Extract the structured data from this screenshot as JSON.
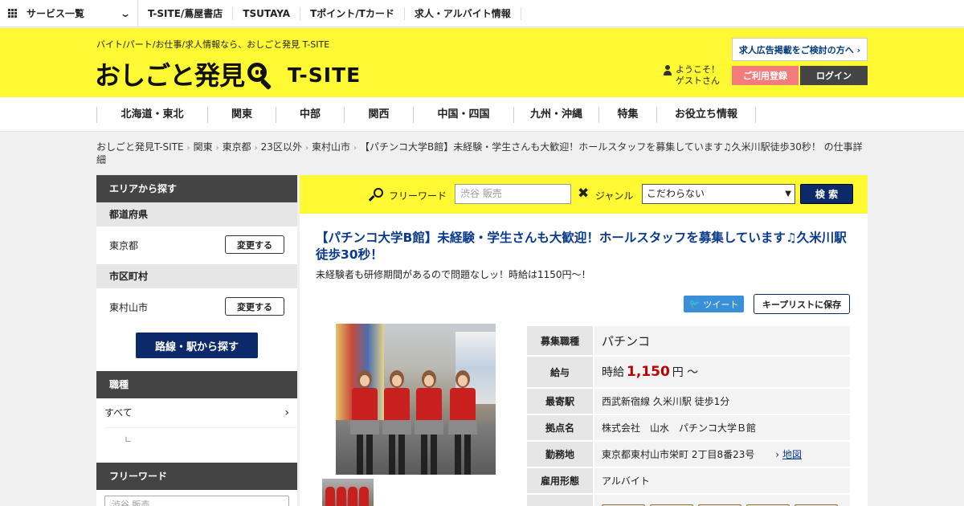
{
  "topbar": {
    "services": "サービス一覧",
    "links": [
      "T-SITE/蔦屋書店",
      "TSUTAYA",
      "Tポイント/Tカード",
      "求人・アルバイト情報"
    ]
  },
  "header": {
    "tagline": "バイト/パート/お仕事/求人情報なら、おしごと発見 T-SITE",
    "logo_main": "おしごと発見",
    "logo_sub": "T-SITE",
    "ad_button": "求人広告掲載をご検討の方へ ›",
    "welcome_line1": "ようこそ！",
    "welcome_line2": "ゲストさん",
    "register": "ご利用登録",
    "login": "ログイン",
    "colors": {
      "yellow": "#fff933",
      "navy": "#0c2a6a",
      "pink": "#f47b7b"
    }
  },
  "nav": {
    "items": [
      "北海道・東北",
      "関東",
      "中部",
      "関西",
      "中国・四国",
      "九州・沖縄",
      "特集",
      "お役立ち情報"
    ]
  },
  "breadcrumb": {
    "items": [
      "おしごと発見T-SITE",
      "関東",
      "東京都",
      "23区以外",
      "東村山市"
    ],
    "current": "【パチンコ大学B館】未経験・学生さんも大歓迎！ホールスタッフを募集しています♫久米川駅徒歩30秒！ の仕事詳細"
  },
  "sidebar": {
    "area_title": "エリアから探す",
    "pref_label": "都道府県",
    "pref_value": "東京都",
    "change1": "変更する",
    "city_label": "市区町村",
    "city_value": "東村山市",
    "change2": "変更する",
    "route_button": "路線・駅から探す",
    "job_title": "職種",
    "job_all": "すべて",
    "job_sub_mark": "∟",
    "freeword_title": "フリーワード",
    "freeword_placeholder": "渋谷 販売"
  },
  "search": {
    "freeword_label": "フリーワード",
    "freeword_placeholder": "渋谷 販売",
    "genre_label": "ジャンル",
    "genre_value": "こだわらない",
    "submit": "検 索"
  },
  "job": {
    "title": "【パチンコ大学B館】未経験・学生さんも大歓迎！ホールスタッフを募集しています♫久米川駅徒歩30秒！",
    "subtitle": "未経験者も研修期間があるので問題なしッ！時給は1150円～！",
    "tweet": "ツイート",
    "keep": "キープリストに保存",
    "rows": {
      "category_label": "募集職種",
      "category": "パチンコ",
      "salary_label": "給与",
      "salary_prefix": "時給",
      "salary_amount": "1,150",
      "salary_suffix": "円 〜",
      "station_label": "最寄駅",
      "station": "西武新宿線 久米川駅 徒歩1分",
      "base_label": "拠点名",
      "base": "株式会社　山水　パチンコ大学Ｂ館",
      "location_label": "勤務地",
      "location": "東京都東村山市栄町 2丁目8番23号",
      "map": "地図",
      "employment_label": "雇用形態",
      "employment": "アルバイト"
    }
  }
}
